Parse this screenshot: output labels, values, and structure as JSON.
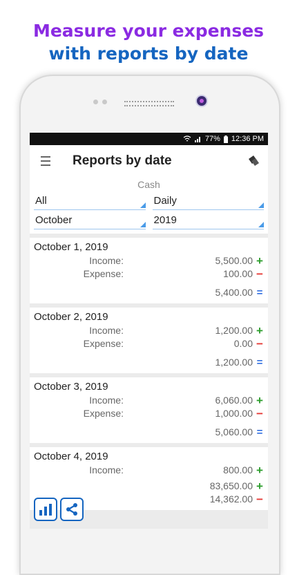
{
  "promo": {
    "line1": "Measure your expenses",
    "line2": "with reports by date"
  },
  "status": {
    "battery": "77%",
    "time": "12:36 PM"
  },
  "appbar": {
    "title": "Reports by date"
  },
  "filters": {
    "account": "Cash",
    "category": "All",
    "period": "Daily",
    "month": "October",
    "year": "2019"
  },
  "symbols": {
    "plus": "+",
    "minus": "−",
    "equals": "="
  },
  "reports": [
    {
      "date": "October 1,  2019",
      "income_label": "Income:",
      "income": "5,500.00",
      "expense_label": "Expense:",
      "expense": "100.00",
      "total": "5,400.00"
    },
    {
      "date": "October 2,  2019",
      "income_label": "Income:",
      "income": "1,200.00",
      "expense_label": "Expense:",
      "expense": "0.00",
      "total": "1,200.00"
    },
    {
      "date": "October 3,  2019",
      "income_label": "Income:",
      "income": "6,060.00",
      "expense_label": "Expense:",
      "expense": "1,000.00",
      "total": "5,060.00"
    },
    {
      "date": "October 4,  2019",
      "income_label": "Income:",
      "income": "800.00"
    }
  ],
  "summary": {
    "income_total": "83,650.00",
    "expense_total": "14,362.00"
  },
  "colors": {
    "headline_purple": "#8B2BE2",
    "headline_blue": "#1565C0",
    "income": "#2e9e2e",
    "expense": "#e53935",
    "total": "#2f6ee0"
  }
}
